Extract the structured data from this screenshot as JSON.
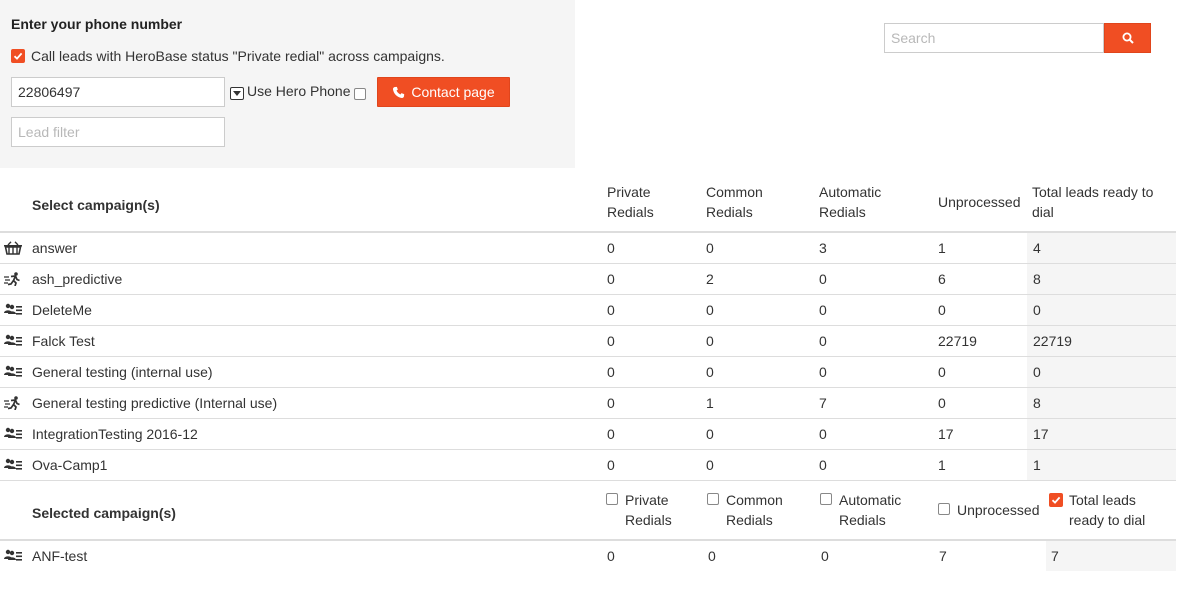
{
  "phone_panel": {
    "heading": "Enter your phone number",
    "call_leads_label": "Call leads with HeroBase status \"Private redial\" across campaigns.",
    "call_leads_checked": true,
    "phone_value": "22806497",
    "use_hero_phone_label": "Use Hero Phone",
    "use_hero_phone_checked": false,
    "contact_button_label": "Contact page",
    "lead_filter_placeholder": "Lead filter"
  },
  "search": {
    "placeholder": "Search"
  },
  "campaigns_table": {
    "title": "Select campaign(s)",
    "columns": [
      "Private Redials",
      "Common Redials",
      "Automatic Redials",
      "Unprocessed",
      "Total leads ready to dial"
    ],
    "rows": [
      {
        "icon": "basket-icon",
        "name": "answer",
        "private": "0",
        "common": "0",
        "automatic": "3",
        "unprocessed": "1",
        "total": "4"
      },
      {
        "icon": "runner-icon",
        "name": "ash_predictive",
        "private": "0",
        "common": "2",
        "automatic": "0",
        "unprocessed": "6",
        "total": "8"
      },
      {
        "icon": "contact-list-icon",
        "name": "DeleteMe",
        "private": "0",
        "common": "0",
        "automatic": "0",
        "unprocessed": "0",
        "total": "0"
      },
      {
        "icon": "contact-list-icon",
        "name": "Falck Test",
        "private": "0",
        "common": "0",
        "automatic": "0",
        "unprocessed": "22719",
        "total": "22719"
      },
      {
        "icon": "contact-list-icon",
        "name": "General testing (internal use)",
        "private": "0",
        "common": "0",
        "automatic": "0",
        "unprocessed": "0",
        "total": "0"
      },
      {
        "icon": "runner-icon",
        "name": "General testing predictive (Internal use)",
        "private": "0",
        "common": "1",
        "automatic": "7",
        "unprocessed": "0",
        "total": "8"
      },
      {
        "icon": "contact-list-icon",
        "name": "IntegrationTesting 2016-12",
        "private": "0",
        "common": "0",
        "automatic": "0",
        "unprocessed": "17",
        "total": "17"
      },
      {
        "icon": "contact-list-icon",
        "name": "Ova-Camp1",
        "private": "0",
        "common": "0",
        "automatic": "0",
        "unprocessed": "1",
        "total": "1"
      }
    ]
  },
  "selected_table": {
    "title": "Selected campaign(s)",
    "options": [
      {
        "label": "Private Redials",
        "checked": false
      },
      {
        "label": "Common Redials",
        "checked": false
      },
      {
        "label": "Automatic Redials",
        "checked": false
      },
      {
        "label": "Unprocessed",
        "checked": false
      },
      {
        "label": "Total leads ready to dial",
        "checked": true
      }
    ],
    "rows": [
      {
        "icon": "contact-list-icon",
        "name": "ANF-test",
        "private": "0",
        "common": "0",
        "automatic": "0",
        "unprocessed": "7",
        "total": "7"
      }
    ]
  },
  "colors": {
    "accent": "#f04e23",
    "panel_bg": "#f5f5f5",
    "border": "#dddddd"
  }
}
